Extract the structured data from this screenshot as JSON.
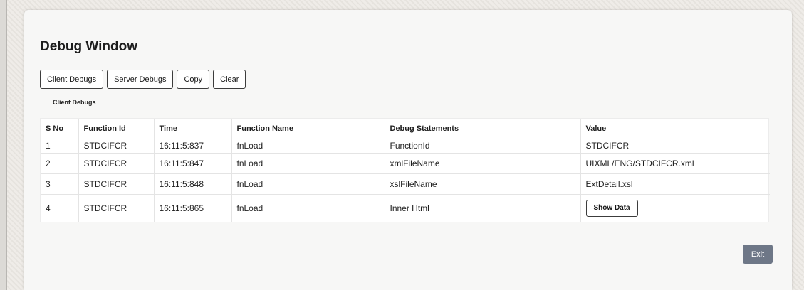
{
  "window": {
    "title": "Debug Window"
  },
  "toolbar": {
    "client_debugs": "Client Debugs",
    "server_debugs": "Server Debugs",
    "copy": "Copy",
    "clear": "Clear"
  },
  "section": {
    "label": "Client Debugs"
  },
  "table": {
    "headers": [
      "S No",
      "Function Id",
      "Time",
      "Function Name",
      "Debug Statements",
      "Value"
    ],
    "rows": [
      {
        "sno": "1",
        "function_id": "STDCIFCR",
        "time": "16:11:5:837",
        "function_name": "fnLoad",
        "statement": "FunctionId",
        "value": "STDCIFCR"
      },
      {
        "sno": "2",
        "function_id": "STDCIFCR",
        "time": "16:11:5:847",
        "function_name": "fnLoad",
        "statement": "xmlFileName",
        "value": "UIXML/ENG/STDCIFCR.xml"
      },
      {
        "sno": "3",
        "function_id": "STDCIFCR",
        "time": "16:11:5:848",
        "function_name": "fnLoad",
        "statement": "xslFileName",
        "value": "ExtDetail.xsl"
      },
      {
        "sno": "4",
        "function_id": "STDCIFCR",
        "time": "16:11:5:865",
        "function_name": "fnLoad",
        "statement": "Inner Html",
        "value_button": "Show Data"
      }
    ]
  },
  "footer": {
    "exit_label": "Exit"
  },
  "colors": {
    "exit_button": "#6e7787",
    "border": "#3c3c3c"
  }
}
